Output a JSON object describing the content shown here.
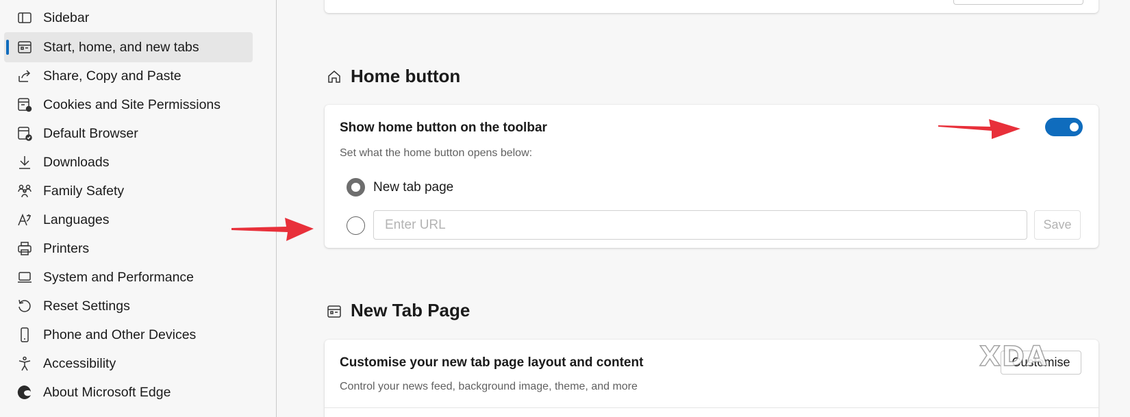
{
  "sidebar": {
    "items": [
      {
        "label": "Sidebar",
        "icon": "sidebar-icon"
      },
      {
        "label": "Start, home, and new tabs",
        "icon": "start-home-tabs-icon",
        "active": true
      },
      {
        "label": "Share, Copy and Paste",
        "icon": "share-icon"
      },
      {
        "label": "Cookies and Site Permissions",
        "icon": "cookies-permissions-icon"
      },
      {
        "label": "Default Browser",
        "icon": "default-browser-icon"
      },
      {
        "label": "Downloads",
        "icon": "download-icon"
      },
      {
        "label": "Family Safety",
        "icon": "family-icon"
      },
      {
        "label": "Languages",
        "icon": "languages-icon"
      },
      {
        "label": "Printers",
        "icon": "printer-icon"
      },
      {
        "label": "System and Performance",
        "icon": "laptop-icon"
      },
      {
        "label": "Reset Settings",
        "icon": "reset-icon"
      },
      {
        "label": "Phone and Other Devices",
        "icon": "phone-icon"
      },
      {
        "label": "Accessibility",
        "icon": "accessibility-icon"
      },
      {
        "label": "About Microsoft Edge",
        "icon": "edge-logo-icon"
      }
    ]
  },
  "home_button": {
    "section_title": "Home button",
    "toggle_title": "Show home button on the toolbar",
    "toggle_on": true,
    "subtitle": "Set what the home button opens below:",
    "option_newtab": "New tab page",
    "url_placeholder": "Enter URL",
    "url_value": "",
    "save_label": "Save"
  },
  "new_tab_page": {
    "section_title": "New Tab Page",
    "customise_title": "Customise your new tab page layout and content",
    "customise_sub": "Control your news feed, background image, theme, and more",
    "customise_button": "Customise"
  },
  "watermark": "XDA",
  "colors": {
    "accent": "#0f6cbd",
    "arrow": "#e8303a",
    "active_bg": "#e6e6e6"
  }
}
